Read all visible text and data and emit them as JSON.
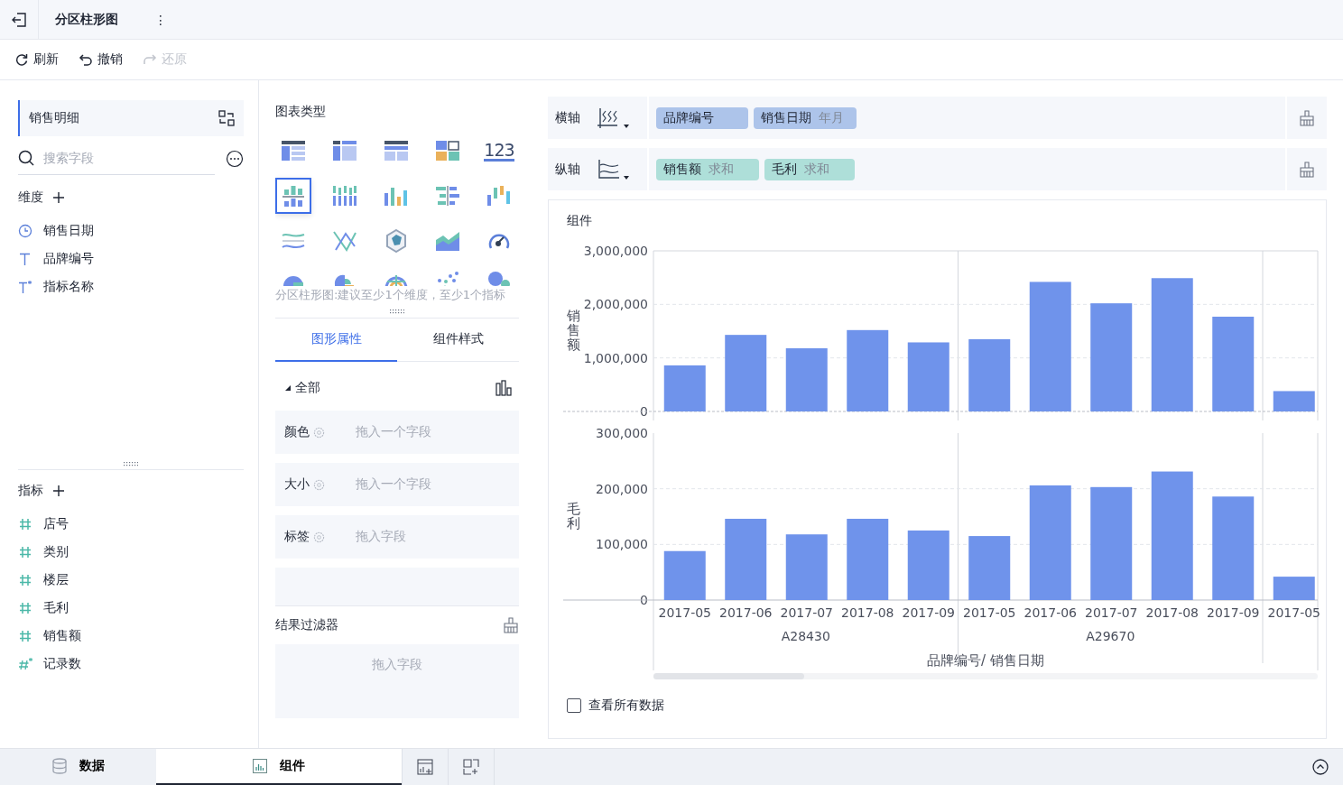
{
  "header": {
    "title": "分区柱形图",
    "menu": "⋮"
  },
  "toolbar": [
    {
      "label": "刷新",
      "kind": "refresh",
      "disabled": false
    },
    {
      "label": "撤销",
      "kind": "undo",
      "disabled": false
    },
    {
      "label": "还原",
      "kind": "redo",
      "disabled": true
    }
  ],
  "dataset": {
    "name": "销售明细"
  },
  "search": {
    "placeholder": "搜索字段"
  },
  "dimensions": {
    "title": "维度",
    "items": [
      {
        "label": "销售日期",
        "kind": "date"
      },
      {
        "label": "品牌编号",
        "kind": "text"
      },
      {
        "label": "指标名称",
        "kind": "text-calc"
      }
    ]
  },
  "measures": {
    "title": "指标",
    "items": [
      {
        "label": "店号",
        "kind": "number"
      },
      {
        "label": "类别",
        "kind": "number"
      },
      {
        "label": "楼层",
        "kind": "number"
      },
      {
        "label": "毛利",
        "kind": "number"
      },
      {
        "label": "销售额",
        "kind": "number"
      },
      {
        "label": "记录数",
        "kind": "number-calc"
      }
    ]
  },
  "chart_types": {
    "title": "图表类型",
    "items": [
      {
        "kind": "table",
        "selected": false
      },
      {
        "kind": "cross-table",
        "selected": false
      },
      {
        "kind": "detail-table",
        "selected": false
      },
      {
        "kind": "blocks",
        "selected": false
      },
      {
        "kind": "number",
        "selected": false,
        "label": "123"
      },
      {
        "kind": "split-bar",
        "selected": true
      },
      {
        "kind": "stacked-bar",
        "selected": false
      },
      {
        "kind": "bar",
        "selected": false
      },
      {
        "kind": "split-hbar",
        "selected": false
      },
      {
        "kind": "range-bar",
        "selected": false
      },
      {
        "kind": "wave",
        "selected": false
      },
      {
        "kind": "cross-lines",
        "selected": false
      },
      {
        "kind": "radar",
        "selected": false
      },
      {
        "kind": "area",
        "selected": false
      },
      {
        "kind": "gauge",
        "selected": false
      },
      {
        "kind": "pie",
        "selected": false
      },
      {
        "kind": "rose",
        "selected": false
      },
      {
        "kind": "sunburst",
        "selected": false
      },
      {
        "kind": "scatter",
        "selected": false
      },
      {
        "kind": "bubble",
        "selected": false
      }
    ],
    "hint": "分区柱形图:建议至少1个维度，至少1个指标"
  },
  "prop_tabs": [
    {
      "label": "图形属性",
      "selected": true
    },
    {
      "label": "组件样式",
      "selected": false
    }
  ],
  "properties": {
    "group": "全部",
    "rows": [
      {
        "label": "颜色",
        "placeholder": "拖入一个字段"
      },
      {
        "label": "大小",
        "placeholder": "拖入一个字段"
      },
      {
        "label": "标签",
        "placeholder": "拖入字段"
      },
      {
        "kind": "cut"
      }
    ]
  },
  "result_filter": {
    "title": "结果过滤器",
    "placeholder": "拖入字段"
  },
  "axes": [
    {
      "label": "横轴",
      "kind": "x",
      "pills": [
        {
          "name": "品牌编号",
          "kind": "dimension"
        },
        {
          "name": "销售日期",
          "suffix": "年月",
          "kind": "dimension"
        }
      ]
    },
    {
      "label": "纵轴",
      "kind": "y",
      "pills": [
        {
          "name": "销售额",
          "suffix": "求和",
          "kind": "measure"
        },
        {
          "name": "毛利",
          "suffix": "求和",
          "kind": "measure"
        }
      ]
    }
  ],
  "widget": {
    "title": "组件",
    "panels": [
      {
        "chart_data": {
          "type": "bar",
          "ylabel": "销售额",
          "ylim": [
            0,
            3000000
          ],
          "yticks": [
            {
              "value": 0,
              "label": "0"
            },
            {
              "value": 1000000,
              "label": "1,000,000"
            },
            {
              "value": 2000000,
              "label": "2,000,000"
            },
            {
              "value": 3000000,
              "label": "3,000,000"
            }
          ],
          "series": [
            {
              "color": "#6f93eb",
              "values": [
                860000,
                1430000,
                1180000,
                1520000,
                1290000,
                1350000,
                2420000,
                2020000,
                2490000,
                1770000,
                380000
              ]
            }
          ]
        }
      },
      {
        "chart_data": {
          "type": "bar",
          "ylabel": "毛利",
          "xlabel": "品牌编号/ 销售日期",
          "categories": [
            "2017-05",
            "2017-06",
            "2017-07",
            "2017-08",
            "2017-09",
            "2017-05",
            "2017-06",
            "2017-07",
            "2017-08",
            "2017-09",
            "2017-05"
          ],
          "ylim": [
            0,
            300000
          ],
          "yticks": [
            {
              "value": 0,
              "label": "0"
            },
            {
              "value": 100000,
              "label": "100,000"
            },
            {
              "value": 200000,
              "label": "200,000"
            },
            {
              "value": 300000,
              "label": "300,000"
            }
          ],
          "series": [
            {
              "color": "#6f93eb",
              "values": [
                88000,
                146000,
                118000,
                146000,
                125000,
                115000,
                206000,
                203000,
                231000,
                186000,
                42000
              ]
            }
          ]
        }
      }
    ],
    "x_groups": [
      {
        "label": "A28430"
      },
      {
        "label": "A29670"
      }
    ],
    "show_all": {
      "label": "查看所有数据",
      "checked": false
    }
  },
  "bottom_tabs": [
    {
      "label": "数据",
      "kind": "data",
      "selected": false
    },
    {
      "label": "组件",
      "kind": "widget",
      "selected": true
    }
  ]
}
